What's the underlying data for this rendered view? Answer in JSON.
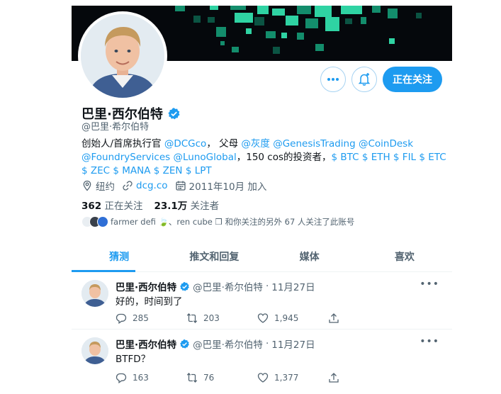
{
  "profile": {
    "name": "巴里·西尔伯特",
    "handle": "@巴里·希尔伯特",
    "bio": {
      "line1_prefix": "创始人/首席执行官 ",
      "dcg": "@DCGco",
      "mid1": "， 父母 ",
      "grayscale": "@灰度",
      "genesis": "@GenesisTrading",
      "coindesk": "@CoinDesk",
      "foundry": "@FoundryServices",
      "luno": "@LunoGlobal",
      "mid2": "，150 cos的投资者，",
      "tickers": "$ BTC $ ETH $ FIL $ ETC $ ZEC $ MANA $ ZEN $ LPT"
    },
    "location": "纽约",
    "website": "dcg.co",
    "joined": "2011年10月 加入",
    "following_count": "362",
    "following_label": "正在关注",
    "followers_count": "23.1万",
    "followers_label": "关注者",
    "mutual_text": "farmer defi 🍃、ren cube ❒ 和你关注的另外 67 人关注了此账号"
  },
  "actions": {
    "more_icon": "more-icon",
    "bell_icon": "bell-plus-icon",
    "follow_label": "正在关注"
  },
  "tabs": [
    {
      "label": "猜测",
      "active": true
    },
    {
      "label": "推文和回复",
      "active": false
    },
    {
      "label": "媒体",
      "active": false
    },
    {
      "label": "喜欢",
      "active": false
    }
  ],
  "tweets": [
    {
      "name": "巴里·西尔伯特",
      "handle": "@巴里·希尔伯特",
      "sep": "·",
      "date": "11月27日",
      "text": "好的，时间到了",
      "replies": "285",
      "retweets": "203",
      "likes": "1,945"
    },
    {
      "name": "巴里·西尔伯特",
      "handle": "@巴里·希尔伯特",
      "sep": "·",
      "date": "11月27日",
      "text": "BTFD？",
      "replies": "163",
      "retweets": "76",
      "likes": "1,377"
    }
  ],
  "colors": {
    "accent": "#1d9bf0",
    "banner": "#05080c",
    "banner_squares": "#2fd3a3"
  }
}
